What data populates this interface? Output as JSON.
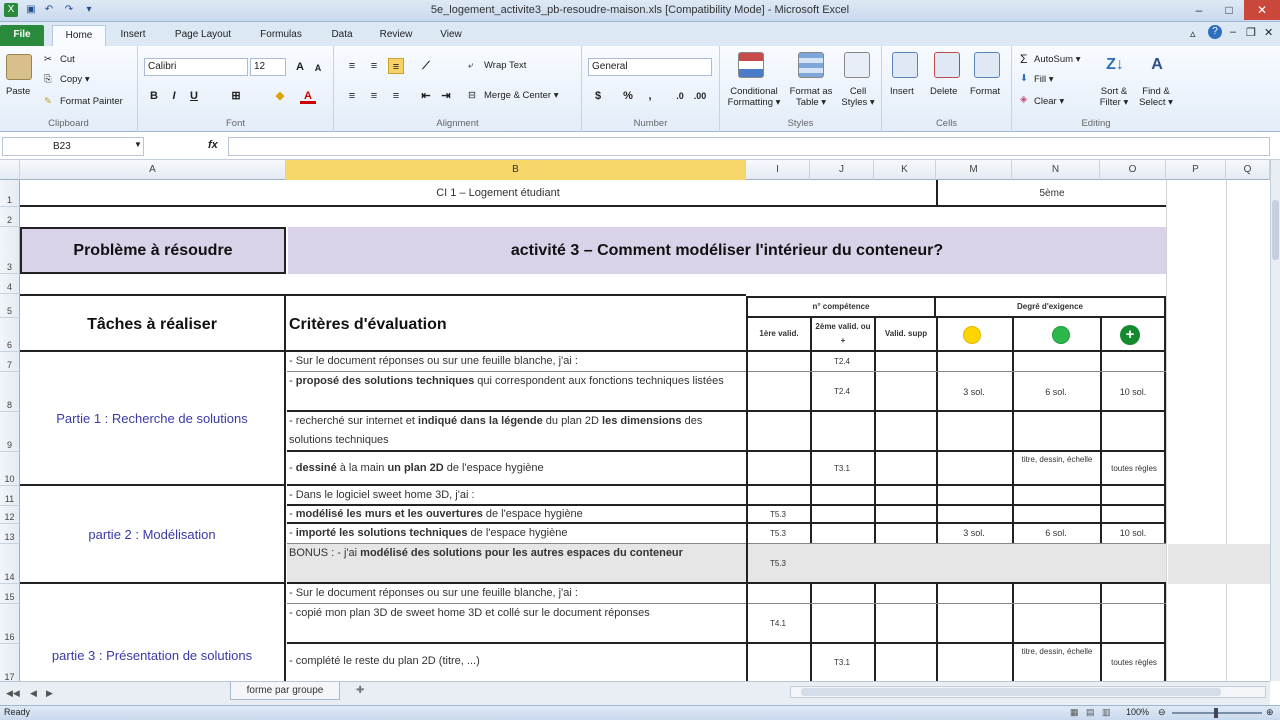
{
  "window": {
    "title": "5e_logement_activite3_pb-resoudre-maison.xls [Compatibility Mode] - Microsoft Excel"
  },
  "tabs": [
    "File",
    "Home",
    "Insert",
    "Page Layout",
    "Formulas",
    "Data",
    "Review",
    "View"
  ],
  "ribbon": {
    "clipboard": {
      "label": "Clipboard",
      "paste": "Paste",
      "cut": "Cut",
      "copy": "Copy ▾",
      "painter": "Format Painter"
    },
    "font": {
      "label": "Font",
      "name": "Calibri",
      "size": "12",
      "grow": "A",
      "shrink": "A",
      "bold": "B",
      "italic": "I",
      "underline": "U"
    },
    "alignment": {
      "label": "Alignment",
      "wrap": "Wrap Text",
      "merge": "Merge & Center ▾"
    },
    "number": {
      "label": "Number",
      "format": "General",
      "percent": "%",
      "comma": ","
    },
    "styles": {
      "label": "Styles",
      "conditional": "Conditional Formatting ▾",
      "format_table": "Format as Table ▾",
      "cell_styles": "Cell Styles ▾"
    },
    "cells": {
      "label": "Cells",
      "insert": "Insert",
      "delete": "Delete",
      "format": "Format"
    },
    "editing": {
      "label": "Editing",
      "autosum": "AutoSum ▾",
      "fill": "Fill ▾",
      "clear": "Clear ▾",
      "sort": "Sort & Filter ▾",
      "find": "Find & Select ▾"
    }
  },
  "formula_bar": {
    "name_box": "B23",
    "fx": "fx",
    "value": ""
  },
  "columns": [
    "A",
    "B",
    "I",
    "J",
    "K",
    "M",
    "N",
    "O",
    "P",
    "Q"
  ],
  "rows": [
    "1",
    "2",
    "3",
    "4",
    "5",
    "6",
    "7",
    "8",
    "9",
    "10",
    "11",
    "12",
    "13",
    "14",
    "15",
    "16",
    "17"
  ],
  "sheet": {
    "r1_title": "CI 1 – Logement étudiant",
    "r1_level": "5ème",
    "r3_problem": "Problème à résoudre",
    "r3_activity": "activité 3 – Comment modéliser l'intérieur du conteneur?",
    "tasks_header": "Tâches à réaliser",
    "criteria_header": "Critères d'évaluation",
    "competence_header": "n° compétence",
    "degree_header": "Degré d'exigence",
    "valid1": "1ère valid.",
    "valid2": "2ème valid. ou +",
    "valid_supp": "Valid. supp",
    "part1": "Partie 1 : Recherche de solutions",
    "part2": "partie 2 : Modélisation",
    "part3": "partie 3 : Présentation de solutions",
    "r7": "- Sur le document réponses ou sur une feuille blanche, j'ai :",
    "r7_j": "T2.4",
    "r8_a": "- ",
    "r8_b": "proposé des solutions techniques",
    "r8_c": " qui correspondent aux fonctions techniques listées",
    "r8_j": "T2.4",
    "r8_m": "3 sol.",
    "r8_n": "6 sol.",
    "r8_o": "10 sol.",
    "r9_a": "- recherché sur internet et ",
    "r9_b": "indiqué dans la légende",
    "r9_c": " du plan 2D ",
    "r9_d": "les dimensions",
    "r9_e": " des solutions techniques",
    "r10_a": "- ",
    "r10_b": "dessiné",
    "r10_c": " à la main ",
    "r10_d": "un plan 2D",
    "r10_e": " de l'espace hygiène",
    "r10_j": "T3.1",
    "r10_n": "titre, dessin, échelle",
    "r10_o": "toutes règles",
    "r11": "- Dans le logiciel sweet home 3D, j'ai :",
    "r12_a": "- ",
    "r12_b": "modélisé les murs et les ouvertures",
    "r12_c": " de l'espace hygiène",
    "r12_i": "T5.3",
    "r13_a": "- ",
    "r13_b": "importé les solutions techniques",
    "r13_c": " de l'espace hygiène",
    "r13_i": "T5.3",
    "r13_m": "3 sol.",
    "r13_n": "6 sol.",
    "r13_o": "10 sol.",
    "r14_a": "BONUS : - j'ai ",
    "r14_b": "modélisé des solutions pour les autres espaces du conteneur",
    "r14_i": "T5.3",
    "r15": "- Sur le document réponses ou sur une feuille blanche, j'ai :",
    "r16": "- copié mon plan 3D de sweet home 3D et collé sur le document réponses",
    "r16_i": "T4.1",
    "r17": "- complété le reste du plan 2D (titre, ...)",
    "r17_j": "T3.1",
    "r17_n": "titre, dessin, échelle",
    "r17_o": "toutes règles"
  },
  "sheet_tabs": [
    "forme par groupe"
  ],
  "status": {
    "ready": "Ready",
    "zoom": "100%"
  },
  "colors": {
    "header_fill": "#d9d2e9",
    "yellow": "#ffd500",
    "green": "#2db84b",
    "dark_green": "#138a2e",
    "selected_col": "#f7d76a"
  }
}
